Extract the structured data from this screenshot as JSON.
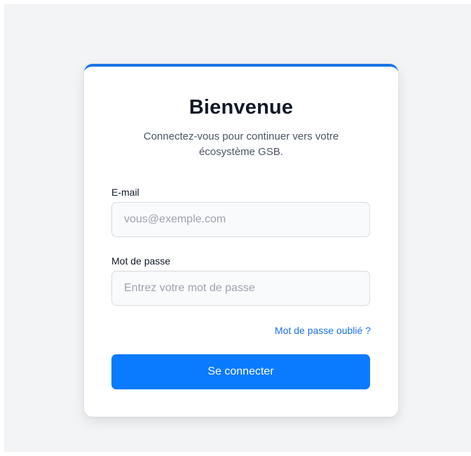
{
  "login": {
    "title": "Bienvenue",
    "subtitle": "Connectez-vous pour continuer vers votre écosystème GSB.",
    "email_label": "E-mail",
    "email_placeholder": "vous@exemple.com",
    "email_value": "",
    "password_label": "Mot de passe",
    "password_placeholder": "Entrez votre mot de passe",
    "password_value": "",
    "forgot_link": "Mot de passe oublié ?",
    "submit_label": "Se connecter"
  },
  "colors": {
    "accent": "#1a73e8",
    "button": "#0a7aff",
    "page_background": "#f3f4f6"
  }
}
